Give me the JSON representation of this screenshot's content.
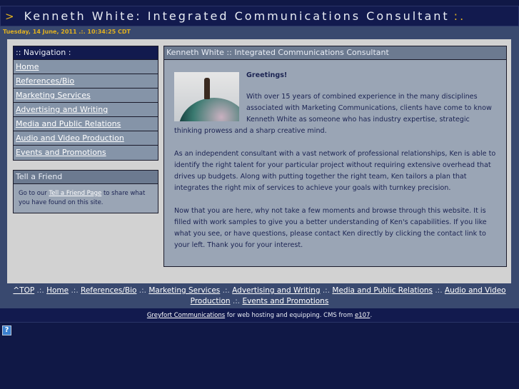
{
  "header": {
    "arrow": ">",
    "title": "Kenneth White: Integrated Communications Consultant",
    "tail": ":."
  },
  "date": "Tuesday, 14 June, 2011 .:. 10:34:25 CDT",
  "nav": {
    "title": ":: Navigation :",
    "items": [
      "Home",
      "References/Bio",
      "Marketing Services",
      "Advertising and Writing",
      "Media and Public Relations",
      "Audio and Video Production",
      "Events and Promotions"
    ]
  },
  "friend": {
    "title": "Tell a Friend",
    "pre": "Go to our ",
    "link": "Tell a Friend Page",
    "post": " to share what you have found on this site."
  },
  "content": {
    "title": "Kenneth White :: Integrated Communications Consultant",
    "greeting": "Greetings!",
    "paragraphs": [
      "With over 15 years of combined experience in the many disciplines associated with Marketing Communications, clients have come to know Kenneth White as someone who has industry expertise, strategic thinking prowess and a sharp creative mind.",
      "As an independent consultant with a vast network of professional relationships, Ken is able to identify the right talent for your particular project without requiring extensive overhead that drives up budgets. Along with putting together the right team, Ken tailors a plan that integrates the right mix of services to achieve your goals with turnkey precision.",
      "Now that you are here, why not take a few moments and browse through this website. It is filled with work samples to give you a better understanding of Ken's capabilities. If you like what you see, or have questions, please contact Ken directly by clicking the contact link to your left. Thank you for your interest."
    ]
  },
  "footer_nav": {
    "sep": " .:. ",
    "items": [
      "^TOP",
      "Home",
      "References/Bio",
      "Marketing Services",
      "Advertising and Writing",
      "Media and Public Relations",
      "Audio and Video Production",
      "Events and Promotions"
    ]
  },
  "credit": {
    "link1": "Greyfort Communications",
    "mid": " for web hosting and equipping. CMS from ",
    "link2": "e107",
    "end": "."
  },
  "help_icon": "?"
}
